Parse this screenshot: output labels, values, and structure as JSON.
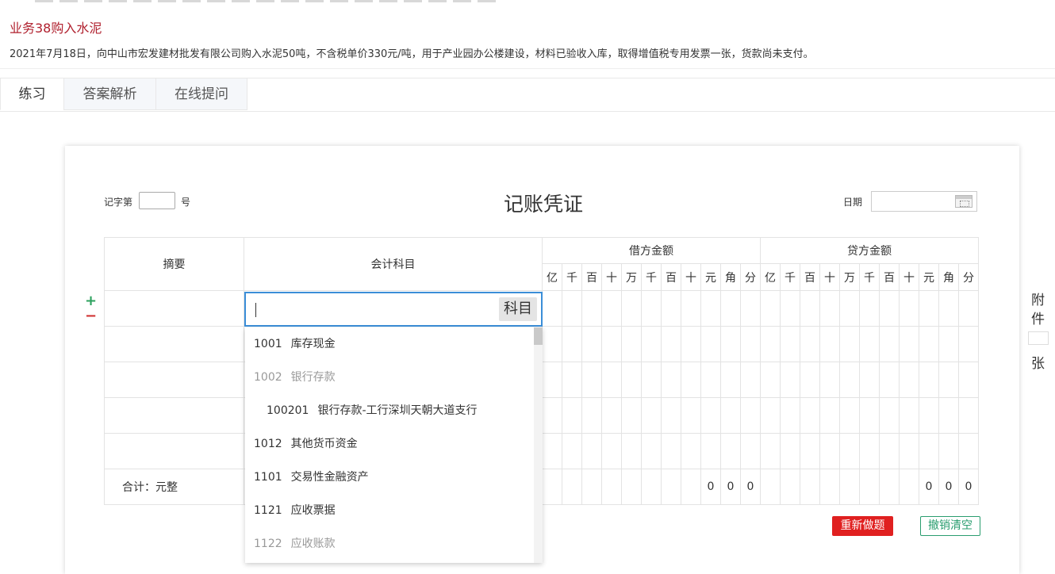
{
  "business": {
    "title": "业务38购入水泥",
    "description": "2021年7月18日，向中山市宏发建材批发有限公司购入水泥50吨，不含税单价330元/吨，用于产业园办公楼建设，材料已验收入库，取得增值税专用发票一张，货款尚未支付。"
  },
  "tabs": [
    {
      "label": "练习",
      "active": true
    },
    {
      "label": "答案解析",
      "active": false
    },
    {
      "label": "在线提问",
      "active": false
    }
  ],
  "voucher": {
    "number_prefix": "记字第",
    "number_suffix": "号",
    "title": "记账凭证",
    "date_label": "日期",
    "headers": {
      "summary": "摘要",
      "account": "会计科目",
      "debit": "借方金额",
      "credit": "贷方金额",
      "digits": [
        "亿",
        "千",
        "百",
        "十",
        "万",
        "千",
        "百",
        "十",
        "元",
        "角",
        "分"
      ]
    },
    "total_label": "合计：元整",
    "debit_total_digits": [
      "0",
      "0",
      "0"
    ],
    "credit_total_digits": [
      "0",
      "0",
      "0"
    ],
    "account_button": "科目",
    "row_add": "+",
    "row_remove": "−"
  },
  "dropdown": {
    "items": [
      {
        "code": "1001",
        "name": "库存现金",
        "muted": false,
        "indent": false
      },
      {
        "code": "1002",
        "name": "银行存款",
        "muted": true,
        "indent": false
      },
      {
        "code": "100201",
        "name": "银行存款-工行深圳天朝大道支行",
        "muted": false,
        "indent": true
      },
      {
        "code": "1012",
        "name": "其他货币资金",
        "muted": false,
        "indent": false
      },
      {
        "code": "1101",
        "name": "交易性金融资产",
        "muted": false,
        "indent": false
      },
      {
        "code": "1121",
        "name": "应收票据",
        "muted": false,
        "indent": false
      },
      {
        "code": "1122",
        "name": "应收账款",
        "muted": true,
        "indent": false
      }
    ]
  },
  "buttons": {
    "redo": "重新做题",
    "clear": "撤销清空"
  },
  "attachment": {
    "label1": "附",
    "label2": "件",
    "unit": "张"
  },
  "colors": {
    "title_red": "#b0202e",
    "redo_bg": "#e02020",
    "clear_green": "#2a9d6f",
    "focus_blue": "#3b8ed8"
  }
}
